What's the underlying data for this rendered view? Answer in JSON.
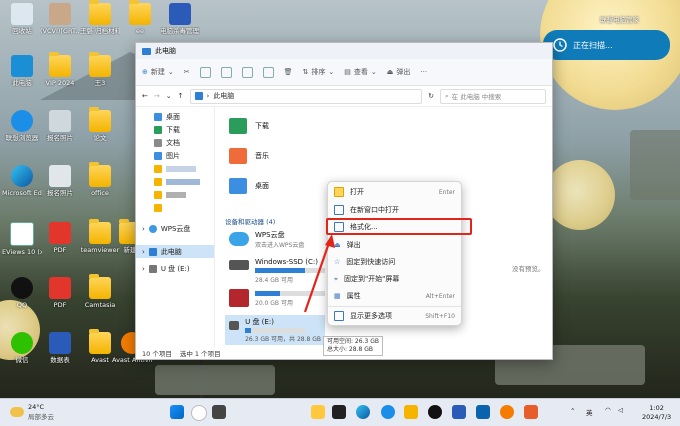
{
  "desktop": {
    "icons": [
      {
        "label": "回收站"
      },
      {
        "label": "(VCVI)[GRT..."
      },
      {
        "label": "王磐\n归档材料"
      },
      {
        "label": "ee"
      },
      {
        "label": "电脑杀毒管理\n助手.docx"
      },
      {
        "label": "此电脑"
      },
      {
        "label": "VIP 2024"
      },
      {
        "label": "王3"
      },
      {
        "label": "联想浏览器"
      },
      {
        "label": "报名照片"
      },
      {
        "label": "论文"
      },
      {
        "label": "Microsoft\nEdge"
      },
      {
        "label": "报名照片"
      },
      {
        "label": "office"
      },
      {
        "label": "EViews 10\n(x64)"
      },
      {
        "label": "PDF"
      },
      {
        "label": "teamviewer"
      },
      {
        "label": "新建"
      },
      {
        "label": "QQ"
      },
      {
        "label": "PDF"
      },
      {
        "label": "Camtasia"
      },
      {
        "label": "微信"
      },
      {
        "label": "数据表"
      },
      {
        "label": "Avast"
      },
      {
        "label": "Avast\nAntivirus"
      }
    ]
  },
  "notification": {
    "text": "正在扫描...",
    "brand": "联想电脑管家"
  },
  "explorer": {
    "title": "此电脑",
    "toolbar": {
      "new": "新建",
      "sort": "排序",
      "view": "查看",
      "eject": "弹出",
      "more": "···"
    },
    "address": "此电脑",
    "search_placeholder": "在 此电脑 中搜索",
    "nav": [
      {
        "label": "桌面"
      },
      {
        "label": "下载"
      },
      {
        "label": "文档"
      },
      {
        "label": "图片"
      },
      {
        "label": "WPS云盘"
      },
      {
        "label": "此电脑"
      },
      {
        "label": "U 盘 (E:)"
      }
    ],
    "folders": [
      {
        "label": "下载"
      },
      {
        "label": "音乐"
      },
      {
        "label": "桌面"
      }
    ],
    "devices_header": "设备和驱动器 (4)",
    "devices": [
      {
        "name": "WPS云盘",
        "desc": "双击进入WPS云盘"
      },
      {
        "name": "Windows-SSD (C:)",
        "desc": "28.4 GB 可用"
      },
      {
        "name": "",
        "desc": "20.0 GB 可用"
      },
      {
        "name": "U 盘 (E:)",
        "desc": "26.3 GB 可用，共 28.8 GB"
      }
    ],
    "right_hint": "没有预览。",
    "status": {
      "count": "10 个项目",
      "selected": "选中 1 个项目"
    }
  },
  "context_menu": {
    "items": [
      {
        "label": "打开",
        "key": "Enter"
      },
      {
        "label": "在新窗口中打开",
        "key": ""
      },
      {
        "label": "格式化...",
        "key": ""
      },
      {
        "label": "弹出",
        "key": ""
      },
      {
        "label": "固定到快速访问",
        "key": ""
      },
      {
        "label": "固定到\"开始\"屏幕",
        "key": ""
      },
      {
        "label": "属性",
        "key": "Alt+Enter"
      },
      {
        "label": "显示更多选项",
        "key": "Shift+F10"
      }
    ]
  },
  "tooltip": {
    "line1": "可用空间: 26.3 GB",
    "line2": "总大小: 28.8 GB"
  },
  "taskbar": {
    "weather_temp": "24°C",
    "weather_desc": "局部多云",
    "ime": "英",
    "time": "1:02",
    "date": "2024/7/3"
  },
  "colors": {
    "accent": "#0f7bb8",
    "highlight": "#e2251b",
    "taskbar": "#e6ebf3"
  }
}
